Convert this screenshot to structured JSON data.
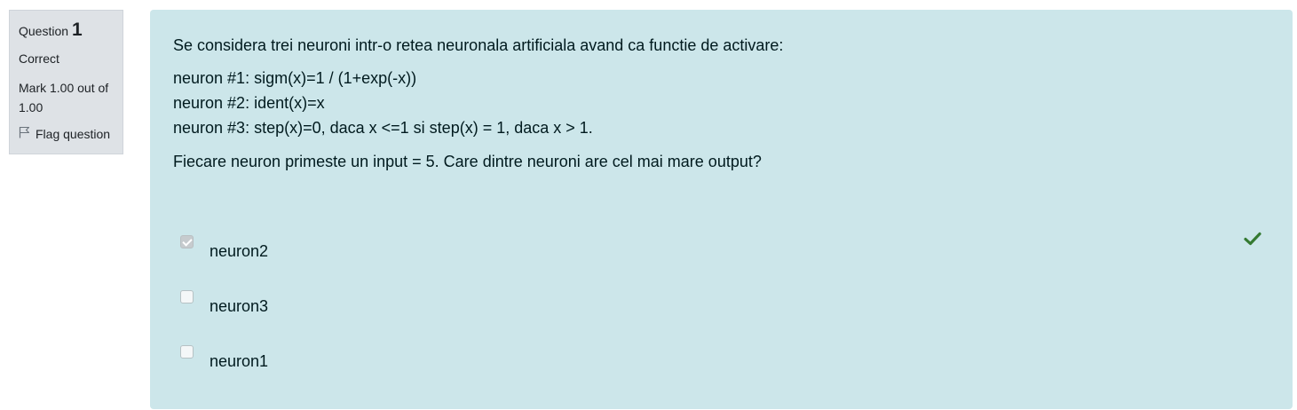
{
  "info": {
    "question_word": "Question",
    "question_number": "1",
    "state": "Correct",
    "grade": "Mark 1.00 out of 1.00",
    "flag_label": "Flag question"
  },
  "question": {
    "intro": "Se considera trei neuroni intr-o retea neuronala artificiala avand ca functie de activare:",
    "lines": [
      "neuron #1: sigm(x)=1 / (1+exp(-x))",
      "neuron #2: ident(x)=x",
      "neuron #3: step(x)=0, daca x <=1 si step(x) = 1, daca x > 1."
    ],
    "prompt": "Fiecare neuron primeste un input = 5. Care dintre neuroni are cel mai mare output?"
  },
  "answers": [
    {
      "label": "neuron2",
      "checked": true
    },
    {
      "label": "neuron3",
      "checked": false
    },
    {
      "label": "neuron1",
      "checked": false
    }
  ],
  "colors": {
    "info_bg": "#dee2e6",
    "content_bg": "#cce6ea",
    "correct_green": "#357a32"
  },
  "icons": {
    "flag": "flag-icon",
    "correct": "check-icon"
  }
}
